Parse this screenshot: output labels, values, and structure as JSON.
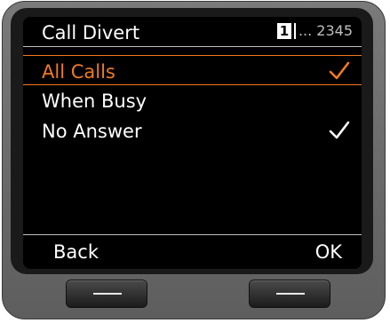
{
  "screen": {
    "title": "Call Divert",
    "line_indicator": {
      "active_line": "1",
      "other_lines": "... 2345"
    }
  },
  "menu": {
    "items": [
      {
        "label": "All Calls",
        "selected": true,
        "checked": true,
        "check_color": "#f07a22"
      },
      {
        "label": "When Busy",
        "selected": false,
        "checked": false,
        "check_color": "#ffffff"
      },
      {
        "label": "No Answer",
        "selected": false,
        "checked": true,
        "check_color": "#ffffff"
      }
    ]
  },
  "softkeys": {
    "left_label": "Back",
    "right_label": "OK"
  },
  "colors": {
    "accent": "#f07a22",
    "screen_background": "#000000",
    "text": "#ffffff",
    "device_body": "#6a6a6a"
  },
  "icons": {
    "check": "check-icon",
    "hardware_key_mark": "dash-icon"
  }
}
